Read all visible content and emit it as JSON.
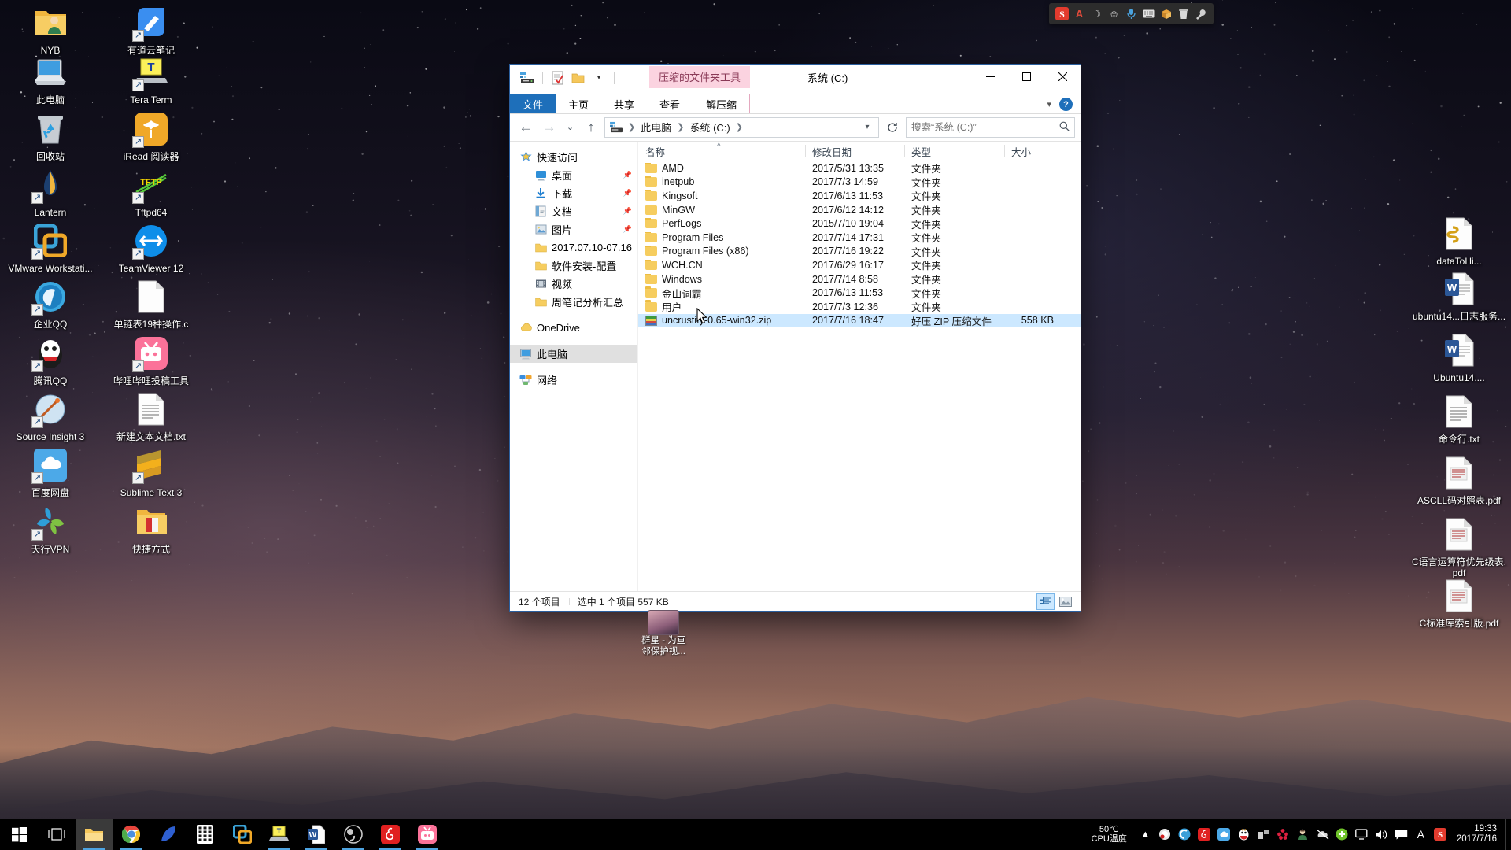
{
  "desktop": {
    "icons_left": [
      {
        "label": "NYB",
        "icon": "user-folder-icon"
      },
      {
        "label": "有道云笔记",
        "icon": "youdao-note-icon"
      },
      {
        "label": "此电脑",
        "icon": "this-pc-icon"
      },
      {
        "label": "Tera Term",
        "icon": "tera-term-icon"
      },
      {
        "label": "回收站",
        "icon": "recycle-bin-icon"
      },
      {
        "label": "iRead 阅读器",
        "icon": "iread-icon"
      },
      {
        "label": "Lantern",
        "icon": "lantern-icon"
      },
      {
        "label": "Tftpd64",
        "icon": "tftpd64-icon"
      },
      {
        "label": "VMware Workstati...",
        "icon": "vmware-icon"
      },
      {
        "label": "TeamViewer 12",
        "icon": "teamviewer-icon"
      },
      {
        "label": "企业QQ",
        "icon": "enterprise-qq-icon"
      },
      {
        "label": "单链表19种操作.c",
        "icon": "c-source-file-icon"
      },
      {
        "label": "腾讯QQ",
        "icon": "tencent-qq-icon"
      },
      {
        "label": "哔哩哔哩投稿工具",
        "icon": "bilibili-upload-icon"
      },
      {
        "label": "Source Insight 3",
        "icon": "source-insight-icon"
      },
      {
        "label": "新建文本文档.txt",
        "icon": "text-file-icon"
      },
      {
        "label": "百度网盘",
        "icon": "baidu-netdisk-icon"
      },
      {
        "label": "Sublime Text 3",
        "icon": "sublime-text-icon"
      },
      {
        "label": "天行VPN",
        "icon": "tianxing-vpn-icon"
      },
      {
        "label": "快捷方式",
        "icon": "shortcut-folder-icon"
      }
    ],
    "icons_right": [
      {
        "label": "dataToHi...",
        "icon": "script-file-icon"
      },
      {
        "label": "ubuntu14...日志服务...",
        "icon": "word-doc-icon"
      },
      {
        "label": "Ubuntu14....",
        "icon": "word-doc-icon"
      },
      {
        "label": "命令行.txt",
        "icon": "text-file-icon"
      },
      {
        "label": "ASCLL码对照表.pdf",
        "icon": "pdf-file-icon"
      },
      {
        "label": "C语言运算符优先级表.pdf",
        "icon": "pdf-file-icon"
      },
      {
        "label": "C标准库索引版.pdf",
        "icon": "pdf-file-icon"
      }
    ],
    "widget": {
      "line1": "群星 - 为亘",
      "line2": "邻保护视..."
    }
  },
  "floatbar": {
    "items": [
      "sogou-logo-icon",
      "a-letter-icon",
      "moon-icon",
      "smiley-icon",
      "mic-icon",
      "keyboard-icon",
      "box-icon",
      "trash-icon",
      "wrench-icon"
    ]
  },
  "explorer": {
    "window_title": "系统 (C:)",
    "contextual_tab_title": "压缩的文件夹工具",
    "quick_access_toolbar": [
      "properties-icon",
      "new-folder-icon",
      "customize-caret-icon"
    ],
    "window_buttons": {
      "minimize": "—",
      "maximize": "□",
      "close": "✕"
    },
    "ribbon_tabs": [
      {
        "label": "文件",
        "active": true
      },
      {
        "label": "主页",
        "active": false
      },
      {
        "label": "共享",
        "active": false
      },
      {
        "label": "查看",
        "active": false
      },
      {
        "label": "解压缩",
        "active": false,
        "contextual": true
      }
    ],
    "ribbon_right": {
      "collapse": "chevron-down-icon",
      "help": "?"
    },
    "navigation": {
      "back": "←",
      "forward": "→",
      "recent": "⌄",
      "up": "↑"
    },
    "breadcrumbs": [
      "此电脑",
      "系统 (C:)"
    ],
    "search": {
      "placeholder": "搜索“系统 (C:)”",
      "value": ""
    },
    "nav_pane": [
      {
        "label": "快速访问",
        "icon": "star-pin-icon",
        "level": 0,
        "pinned": false,
        "selected": false
      },
      {
        "label": "桌面",
        "icon": "desktop-icon",
        "level": 1,
        "pinned": true,
        "selected": false
      },
      {
        "label": "下载",
        "icon": "download-icon",
        "level": 1,
        "pinned": true,
        "selected": false
      },
      {
        "label": "文档",
        "icon": "documents-icon",
        "level": 1,
        "pinned": true,
        "selected": false
      },
      {
        "label": "图片",
        "icon": "pictures-icon",
        "level": 1,
        "pinned": true,
        "selected": false
      },
      {
        "label": "2017.07.10-07.16",
        "icon": "folder-icon",
        "level": 1,
        "pinned": false,
        "selected": false
      },
      {
        "label": "软件安装-配置",
        "icon": "folder-icon",
        "level": 1,
        "pinned": false,
        "selected": false
      },
      {
        "label": "视频",
        "icon": "videos-icon",
        "level": 1,
        "pinned": false,
        "selected": false
      },
      {
        "label": "周笔记分析汇总",
        "icon": "folder-icon",
        "level": 1,
        "pinned": false,
        "selected": false
      },
      {
        "label": "OneDrive",
        "icon": "onedrive-icon",
        "level": 0,
        "pinned": false,
        "selected": false
      },
      {
        "label": "此电脑",
        "icon": "this-pc-icon",
        "level": 0,
        "pinned": false,
        "selected": true
      },
      {
        "label": "网络",
        "icon": "network-icon",
        "level": 0,
        "pinned": false,
        "selected": false
      }
    ],
    "columns": [
      {
        "label": "名称",
        "sorted": true
      },
      {
        "label": "修改日期",
        "sorted": false
      },
      {
        "label": "类型",
        "sorted": false
      },
      {
        "label": "大小",
        "sorted": false
      }
    ],
    "files": [
      {
        "name": "AMD",
        "date": "2017/5/31 13:35",
        "type": "文件夹",
        "size": "",
        "kind": "folder",
        "selected": false
      },
      {
        "name": "inetpub",
        "date": "2017/7/3 14:59",
        "type": "文件夹",
        "size": "",
        "kind": "folder",
        "selected": false
      },
      {
        "name": "Kingsoft",
        "date": "2017/6/13 11:53",
        "type": "文件夹",
        "size": "",
        "kind": "folder",
        "selected": false
      },
      {
        "name": "MinGW",
        "date": "2017/6/12 14:12",
        "type": "文件夹",
        "size": "",
        "kind": "folder",
        "selected": false
      },
      {
        "name": "PerfLogs",
        "date": "2015/7/10 19:04",
        "type": "文件夹",
        "size": "",
        "kind": "folder",
        "selected": false
      },
      {
        "name": "Program Files",
        "date": "2017/7/14 17:31",
        "type": "文件夹",
        "size": "",
        "kind": "folder",
        "selected": false
      },
      {
        "name": "Program Files (x86)",
        "date": "2017/7/16 19:22",
        "type": "文件夹",
        "size": "",
        "kind": "folder",
        "selected": false
      },
      {
        "name": "WCH.CN",
        "date": "2017/6/29 16:17",
        "type": "文件夹",
        "size": "",
        "kind": "folder",
        "selected": false
      },
      {
        "name": "Windows",
        "date": "2017/7/14 8:58",
        "type": "文件夹",
        "size": "",
        "kind": "folder",
        "selected": false
      },
      {
        "name": "金山词霸",
        "date": "2017/6/13 11:53",
        "type": "文件夹",
        "size": "",
        "kind": "folder",
        "selected": false
      },
      {
        "name": "用户",
        "date": "2017/7/3 12:36",
        "type": "文件夹",
        "size": "",
        "kind": "folder",
        "selected": false
      },
      {
        "name": "uncrustify-0.65-win32.zip",
        "date": "2017/7/16 18:47",
        "type": "好压 ZIP 压缩文件",
        "size": "558 KB",
        "kind": "zip",
        "selected": true
      }
    ],
    "status": {
      "items": "12 个项目",
      "selection": "选中 1 个项目  557 KB"
    },
    "view_buttons": [
      {
        "name": "details-view",
        "active": true
      },
      {
        "name": "large-icons-view",
        "active": false
      }
    ]
  },
  "taskbar": {
    "start": "windows-logo-icon",
    "task_view": "task-view-icon",
    "apps": [
      {
        "name": "file-explorer",
        "icon": "folder-icon",
        "running": true,
        "active": true
      },
      {
        "name": "chrome",
        "icon": "chrome-icon",
        "running": true,
        "active": false
      },
      {
        "name": "wireshark",
        "icon": "wireshark-icon",
        "running": false,
        "active": false
      },
      {
        "name": "calculator",
        "icon": "calculator-icon",
        "running": false,
        "active": false
      },
      {
        "name": "vmware",
        "icon": "vmware-icon",
        "running": false,
        "active": false
      },
      {
        "name": "tera-term",
        "icon": "tera-term-icon",
        "running": true,
        "active": false
      },
      {
        "name": "word",
        "icon": "word-icon",
        "running": true,
        "active": false
      },
      {
        "name": "obs",
        "icon": "obs-icon",
        "running": true,
        "active": false
      },
      {
        "name": "netease-music",
        "icon": "netease-music-icon",
        "running": true,
        "active": false
      },
      {
        "name": "bilibili",
        "icon": "bilibili-icon",
        "running": true,
        "active": false
      }
    ],
    "cpu_temp": {
      "value": "50℃",
      "label": "CPU温度"
    },
    "tray": [
      "chevron-up-icon",
      "antivirus-icon",
      "sogou-browser-icon",
      "netease-music-icon",
      "baidu-netdisk-icon",
      "qq-icon",
      "app-icon",
      "flower-icon",
      "contact-icon",
      "cloud-icon",
      "plus-circle-icon",
      "display-icon",
      "volume-icon"
    ],
    "tray_extra": [
      "action-center-icon",
      "ime-a-icon",
      "sogou-ime-icon"
    ],
    "clock": {
      "time": "19:33",
      "date": "2017/7/16"
    }
  }
}
